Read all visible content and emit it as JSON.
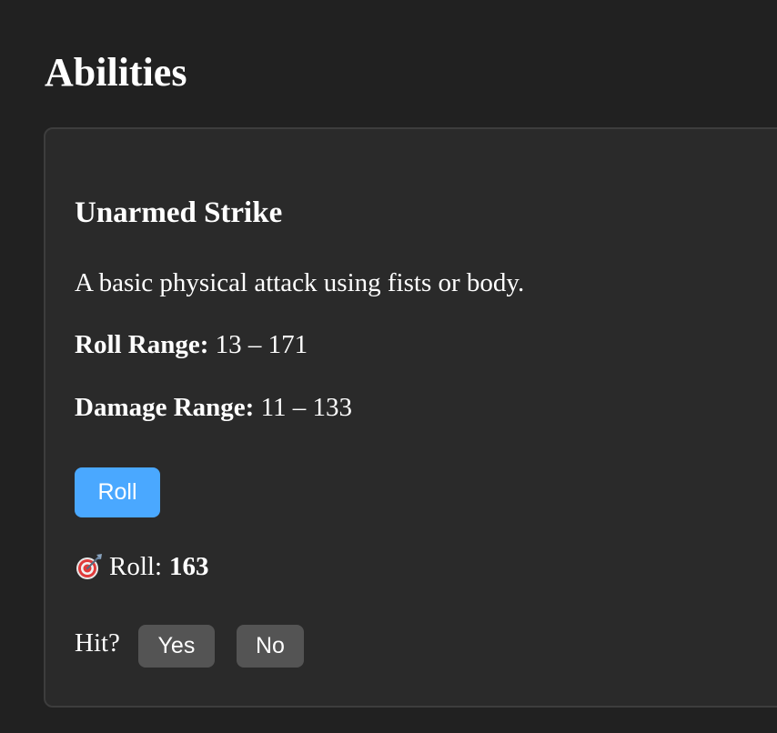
{
  "page": {
    "title": "Abilities"
  },
  "ability": {
    "name": "Unarmed Strike",
    "description": "A basic physical attack using fists or body.",
    "roll_range_label": "Roll Range:",
    "roll_range_value": "13 – 171",
    "damage_range_label": "Damage Range:",
    "damage_range_value": "11 – 133",
    "roll_button_label": "Roll",
    "roll_result_label": "Roll:",
    "roll_result_value": "163",
    "roll_result_icon": "dart-target-icon",
    "hit_prompt": "Hit?",
    "yes_label": "Yes",
    "no_label": "No"
  },
  "colors": {
    "background": "#212121",
    "card": "#2a2a2a",
    "card_border": "#3d3d3d",
    "roll_button": "#4aa8ff",
    "hit_button": "#545454",
    "text": "#ffffff"
  }
}
